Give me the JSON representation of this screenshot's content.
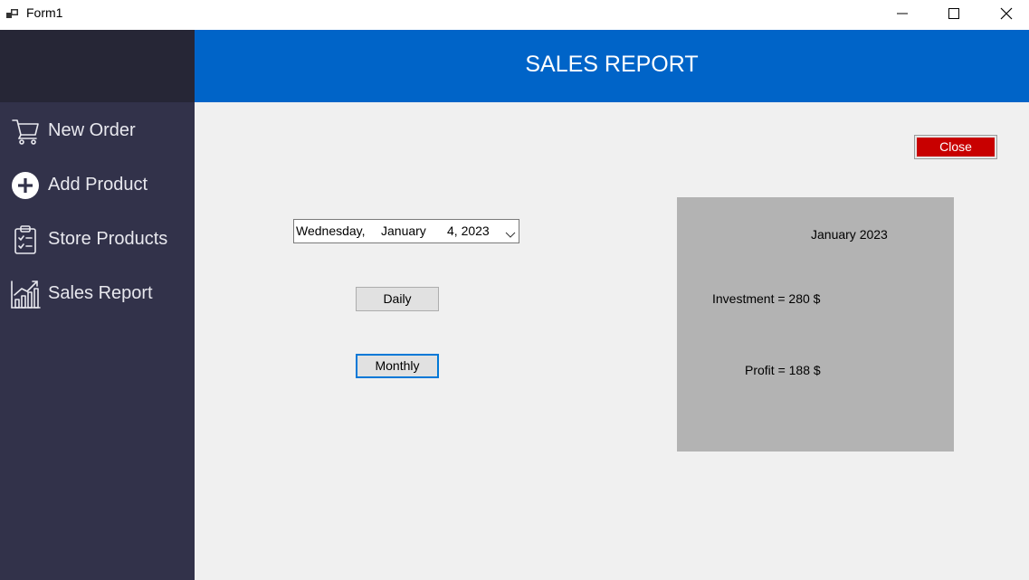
{
  "window": {
    "title": "Form1"
  },
  "sidebar": {
    "items": [
      {
        "label": "New Order",
        "icon": "cart-icon"
      },
      {
        "label": "Add Product",
        "icon": "plus-circle-icon"
      },
      {
        "label": "Store Products",
        "icon": "clipboard-check-icon"
      },
      {
        "label": "Sales Report",
        "icon": "chart-icon"
      }
    ]
  },
  "header": {
    "title": "SALES REPORT"
  },
  "controls": {
    "close_label": "Close",
    "date_picker": {
      "weekday": "Wednesday,",
      "month": "January",
      "day_year": "4, 2023"
    },
    "daily_label": "Daily",
    "monthly_label": "Monthly"
  },
  "report": {
    "period": "January 2023",
    "investment": "Investment = 280 $",
    "profit": "Profit = 188 $"
  },
  "colors": {
    "sidebar_bg": "#32324a",
    "sidebar_logo_bg": "#262636",
    "header_bg": "#0064c8",
    "close_button_bg": "#c80000",
    "report_panel_bg": "#b3b3b3",
    "content_bg": "#f0f0f0"
  }
}
